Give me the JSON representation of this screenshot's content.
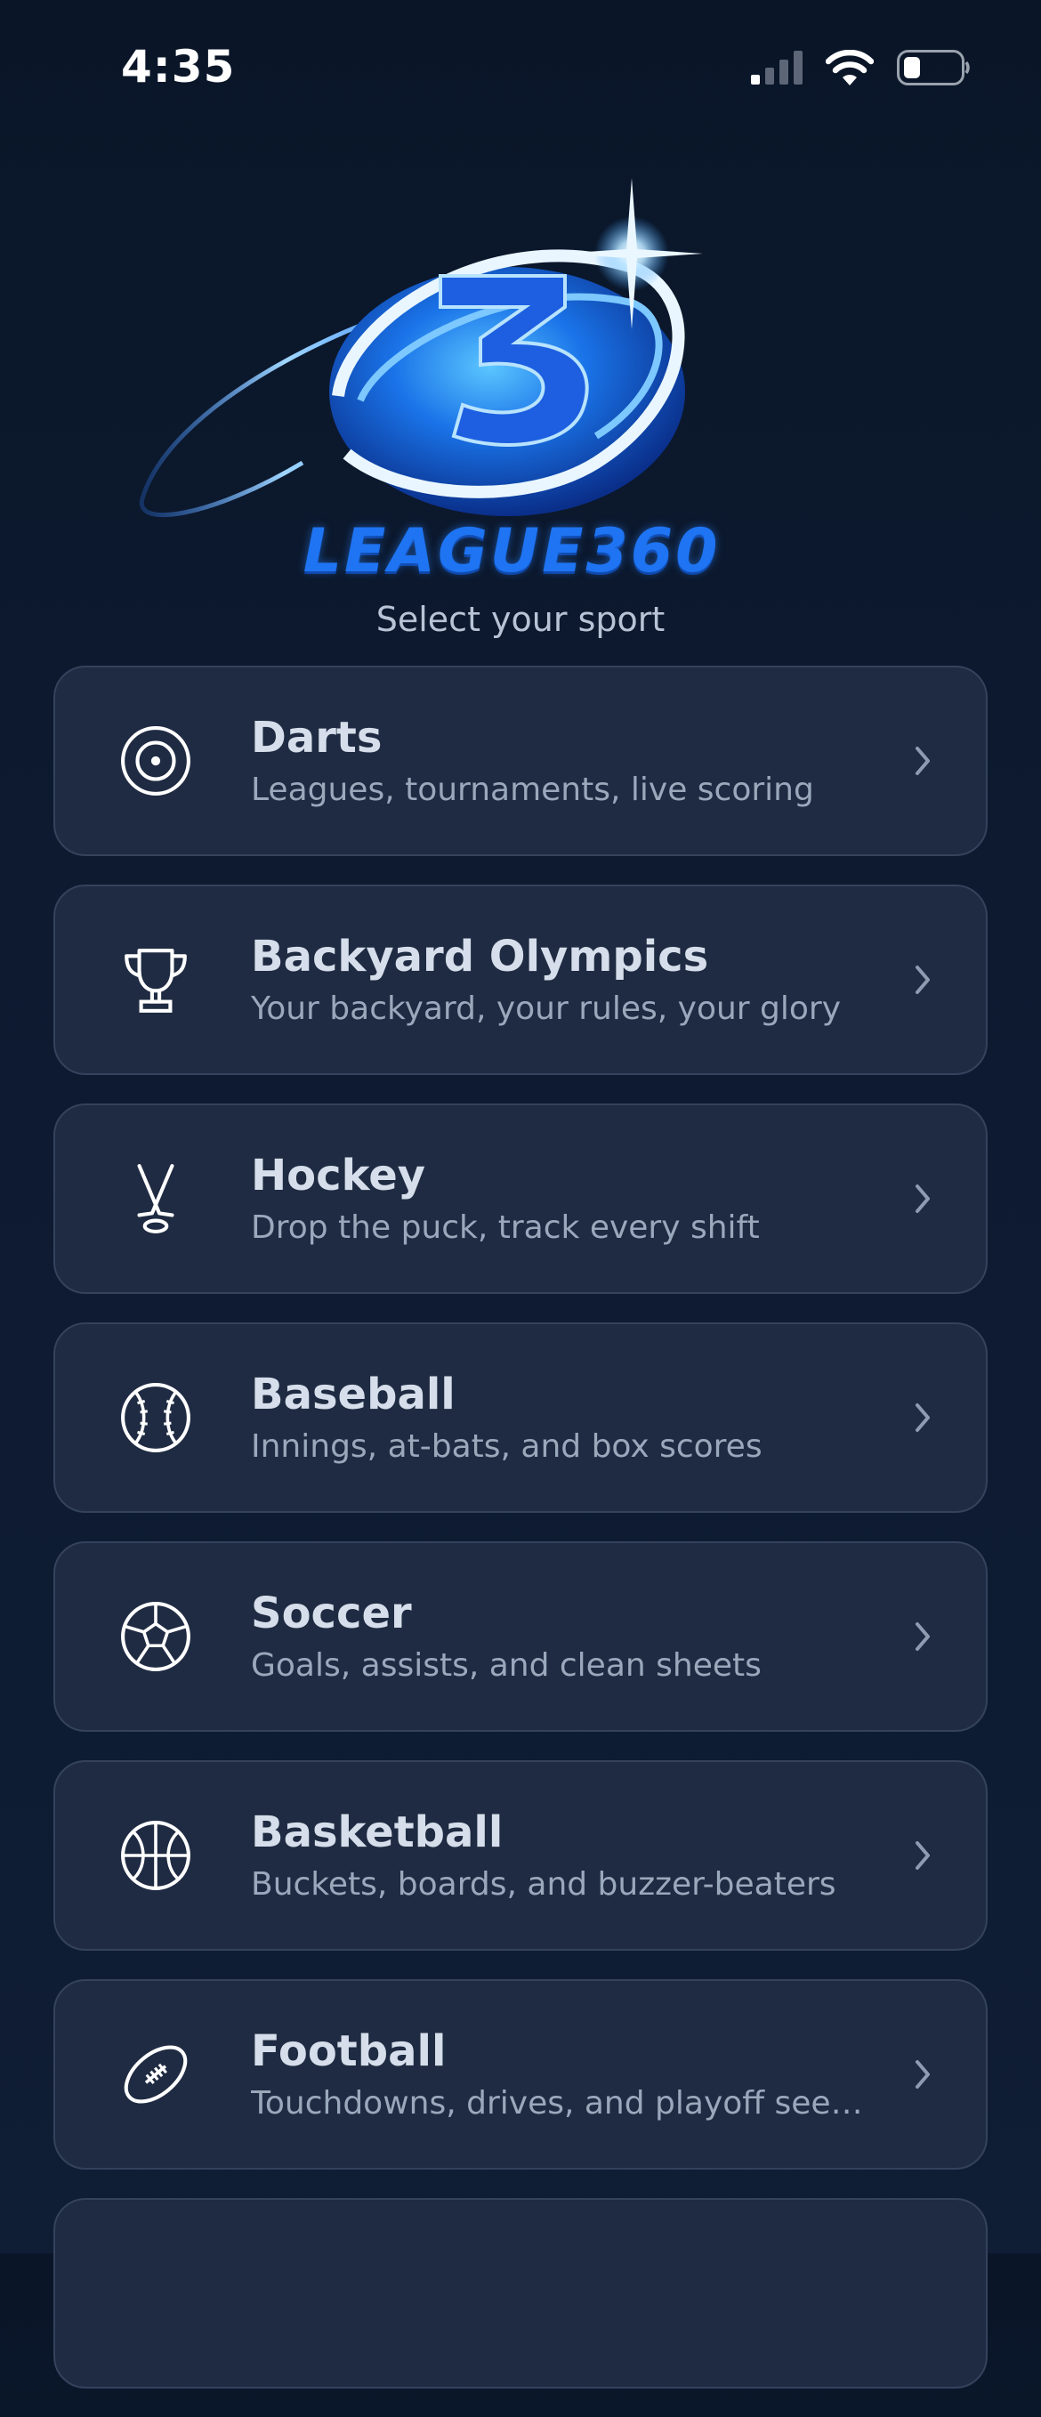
{
  "status_bar": {
    "time": "4:35"
  },
  "header": {
    "logo_text": "LEAGUE360",
    "subtitle": "Select your sport"
  },
  "sports": [
    {
      "title": "Darts",
      "description": "Leagues, tournaments, live scoring",
      "icon": "dartboard-icon"
    },
    {
      "title": "Backyard Olympics",
      "description": "Your backyard, your rules, your glory",
      "icon": "trophy-icon"
    },
    {
      "title": "Hockey",
      "description": "Drop the puck, track every shift",
      "icon": "hockey-sticks-icon"
    },
    {
      "title": "Baseball",
      "description": "Innings, at-bats, and box scores",
      "icon": "baseball-icon"
    },
    {
      "title": "Soccer",
      "description": "Goals, assists, and clean sheets",
      "icon": "soccer-ball-icon"
    },
    {
      "title": "Basketball",
      "description": "Buckets, boards, and buzzer-beaters",
      "icon": "basketball-icon"
    },
    {
      "title": "Football",
      "description": "Touchdowns, drives, and playoff seedi...",
      "icon": "football-icon"
    }
  ],
  "colors": {
    "background": "#0d1a30",
    "card_background": "#1f2b42",
    "card_border": "#34425c",
    "accent": "#1e74f2",
    "title_text": "#d5deea",
    "description_text": "#9aa8bc"
  }
}
